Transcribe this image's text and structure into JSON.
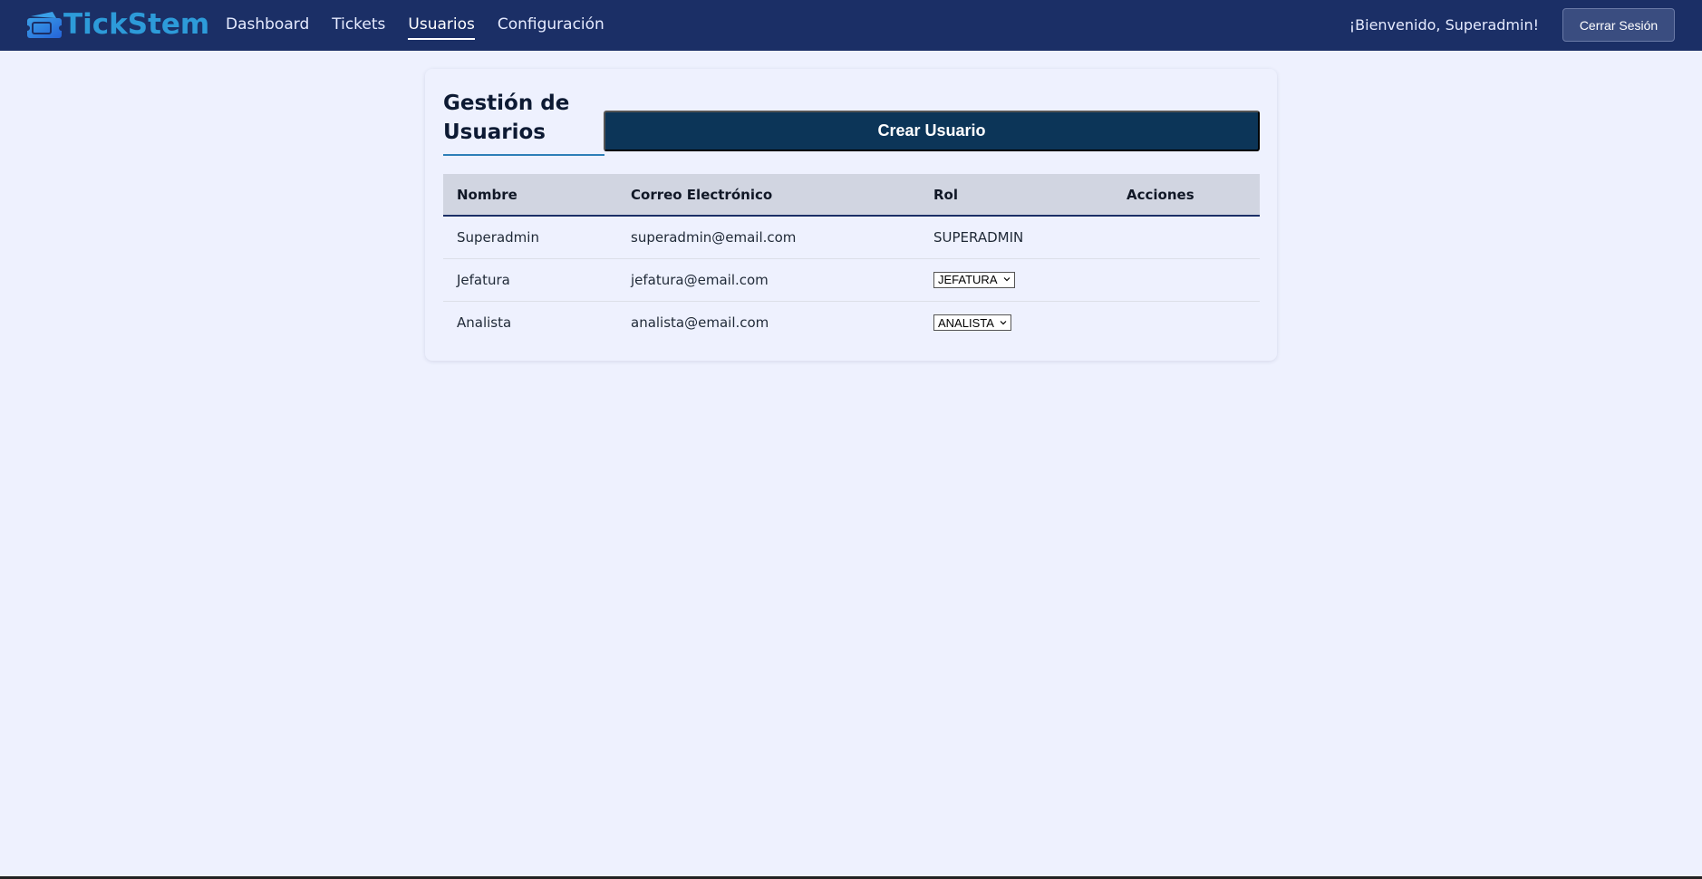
{
  "app": {
    "logo_text": "TickStem"
  },
  "nav": {
    "items": [
      {
        "label": "Dashboard",
        "active": false
      },
      {
        "label": "Tickets",
        "active": false
      },
      {
        "label": "Usuarios",
        "active": true
      },
      {
        "label": "Configuración",
        "active": false
      }
    ],
    "welcome": "¡Bienvenido, Superadmin!",
    "logout_label": "Cerrar Sesión"
  },
  "page": {
    "title": "Gestión de Usuarios",
    "create_button": "Crear Usuario"
  },
  "table": {
    "headers": [
      "Nombre",
      "Correo Electrónico",
      "Rol",
      "Acciones"
    ],
    "rows": [
      {
        "name": "Superadmin",
        "email": "superadmin@email.com",
        "role": "SUPERADMIN",
        "role_editable": false
      },
      {
        "name": "Jefatura",
        "email": "jefatura@email.com",
        "role": "JEFATURA",
        "role_editable": true
      },
      {
        "name": "Analista",
        "email": "analista@email.com",
        "role": "ANALISTA",
        "role_editable": true
      }
    ]
  },
  "colors": {
    "navbar": "#1b2f66",
    "accent": "#2d9bd9",
    "primary_button": "#0c3558",
    "background": "#eef1fe",
    "table_header": "#d1d5e1"
  },
  "icons": {
    "logo": "ticket-icon",
    "select_arrow": "chevron-down-icon"
  }
}
